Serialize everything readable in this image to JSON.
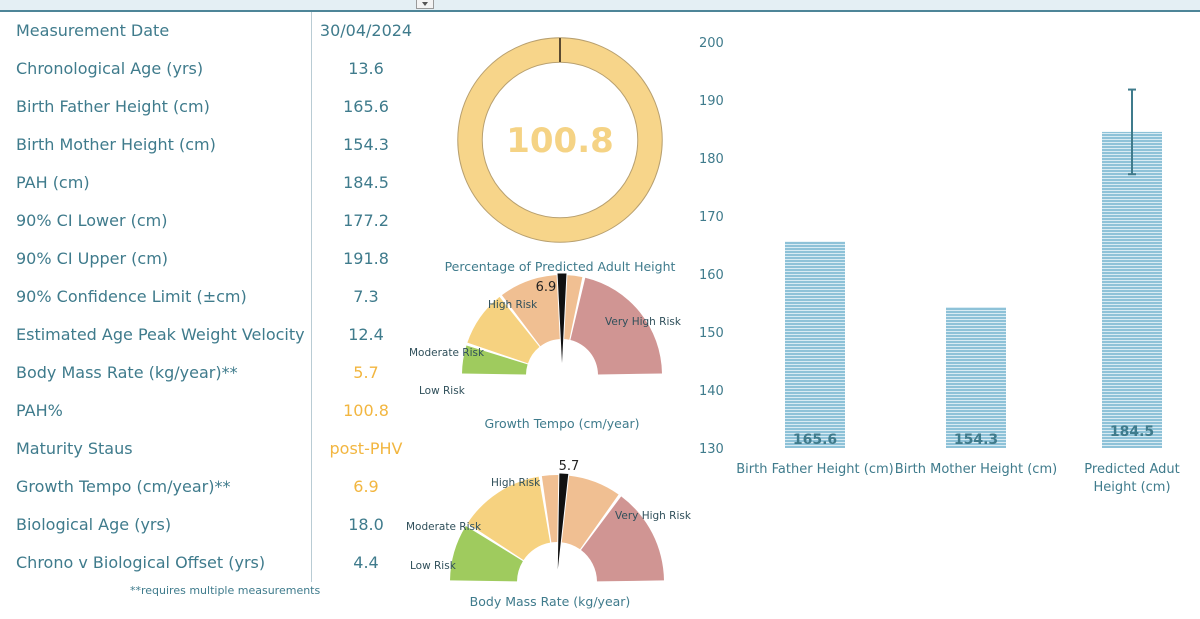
{
  "toolbar": {
    "dropdown_icon": "chevron-down-icon"
  },
  "metrics": [
    {
      "label": "Measurement Date",
      "value": "30/04/2024",
      "highlight": false
    },
    {
      "label": "Chronological Age (yrs)",
      "value": "13.6",
      "highlight": false
    },
    {
      "label": "Birth Father Height (cm)",
      "value": "165.6",
      "highlight": false
    },
    {
      "label": "Birth Mother Height (cm)",
      "value": "154.3",
      "highlight": false
    },
    {
      "label": "PAH (cm)",
      "value": "184.5",
      "highlight": false
    },
    {
      "label": "90% CI Lower (cm)",
      "value": "177.2",
      "highlight": false
    },
    {
      "label": "90% CI Upper (cm)",
      "value": "191.8",
      "highlight": false
    },
    {
      "label": "90% Confidence Limit (±cm)",
      "value": "7.3",
      "highlight": false
    },
    {
      "label": "Estimated Age Peak Weight Velocity",
      "value": "12.4",
      "highlight": false
    },
    {
      "label": "Body Mass Rate (kg/year)**",
      "value": "5.7",
      "highlight": true
    },
    {
      "label": "PAH%",
      "value": "100.8",
      "highlight": true
    },
    {
      "label": "Maturity Staus",
      "value": "post-PHV",
      "highlight": true
    },
    {
      "label": "Growth Tempo (cm/year)**",
      "value": "6.9",
      "highlight": true
    },
    {
      "label": "Biological Age (yrs)",
      "value": "18.0",
      "highlight": false
    },
    {
      "label": "Chrono v Biological Offset (yrs)",
      "value": "4.4",
      "highlight": false
    }
  ],
  "footnote": "**requires multiple measurements",
  "colors": {
    "text": "#3f7b8c",
    "highlight": "#f2b640",
    "donut_fill": "#f7d58a",
    "donut_value": "#f5d385",
    "low": "#9fcb5e",
    "moderate": "#f6d280",
    "high": "#f0bf92",
    "very_high": "#d09593",
    "needle": "#111111",
    "bar_fill": "#8ec2d8",
    "bar_line": "#ffffff",
    "bar_label": "#3f7b8c",
    "errorbar": "#3f7b8c"
  },
  "chart_data": [
    {
      "type": "pie",
      "title": "Percentage of Predicted Adult Height",
      "center_value": "100.8",
      "value": 100.8,
      "max": 100
    },
    {
      "type": "gauge",
      "title": "Growth Tempo (cm/year)",
      "value": 6.9,
      "value_label": "6.9",
      "segments": [
        {
          "name": "Low Risk",
          "fraction": 0.1,
          "color_key": "low"
        },
        {
          "name": "Moderate  Risk",
          "fraction": 0.19,
          "color_key": "moderate"
        },
        {
          "name": "High Risk",
          "fraction": 0.22,
          "color_key": "high"
        },
        {
          "name": "High Risk (cont.)",
          "fraction": 0.06,
          "color_key": "high"
        },
        {
          "name": "Very High Risk",
          "fraction": 0.43,
          "color_key": "very_high"
        }
      ],
      "needle_fraction": 0.5,
      "labels": [
        "Low Risk",
        "Moderate  Risk",
        "High Risk",
        "Very High Risk"
      ]
    },
    {
      "type": "gauge",
      "title": "Body Mass Rate (kg/year)",
      "value": 5.7,
      "value_label": "5.7",
      "segments": [
        {
          "name": "Low Risk",
          "fraction": 0.18,
          "color_key": "low"
        },
        {
          "name": "Moderate  Risk",
          "fraction": 0.27,
          "color_key": "moderate"
        },
        {
          "name": "High Risk",
          "fraction": 0.08,
          "color_key": "high"
        },
        {
          "name": "High Risk (cont.)",
          "fraction": 0.17,
          "color_key": "high"
        },
        {
          "name": "Very High Risk",
          "fraction": 0.3,
          "color_key": "very_high"
        }
      ],
      "needle_fraction": 0.52,
      "labels": [
        "Low Risk",
        "Moderate  Risk",
        "High Risk",
        "Very High Risk"
      ]
    },
    {
      "type": "bar",
      "title": "",
      "categories": [
        "Birth Father Height (cm)",
        "Birth Mother Height (cm)",
        "Predicted Adut Height (cm)"
      ],
      "category_lines": [
        [
          "Birth Father Height (cm)"
        ],
        [
          "Birth Mother Height (cm)"
        ],
        [
          "Predicted Adut",
          "Height (cm)"
        ]
      ],
      "values": [
        165.6,
        154.3,
        184.5
      ],
      "value_labels": [
        "165.6",
        "154.3",
        "184.5"
      ],
      "error": [
        null,
        null,
        {
          "lower": 177.2,
          "upper": 191.8
        }
      ],
      "ylim": [
        130,
        200
      ],
      "yticks": [
        130,
        140,
        150,
        160,
        170,
        180,
        190,
        200
      ],
      "xlabel": "",
      "ylabel": "",
      "grid": false
    }
  ]
}
